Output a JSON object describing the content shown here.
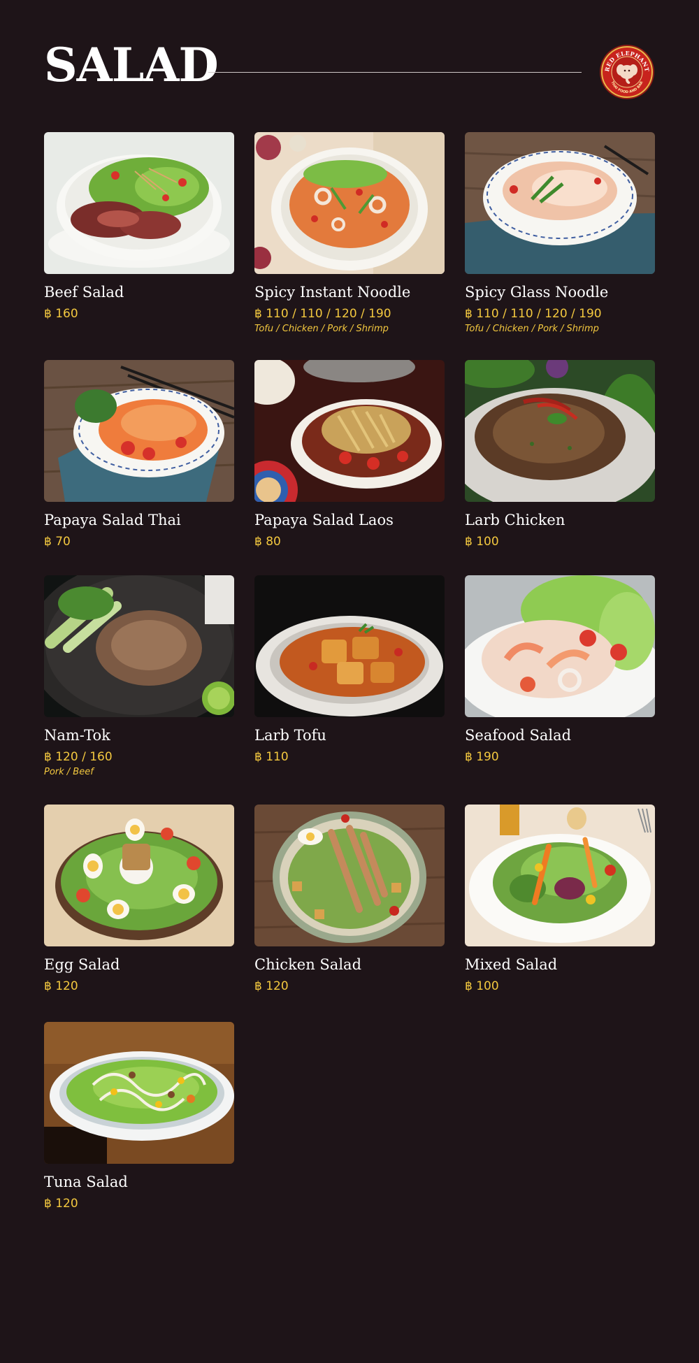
{
  "header": {
    "title": "SALAD",
    "logo": {
      "top_text": "RED ELEPHANT",
      "bottom_text": "THAI FOOD AND BAR",
      "icon": "elephant-icon"
    }
  },
  "colors": {
    "background": "#1e1418",
    "title": "#ffffff",
    "price": "#f3c83f",
    "logo_red": "#c8231d"
  },
  "menu": {
    "items": [
      {
        "name": "Beef Salad",
        "price": "฿ 160",
        "variants": "",
        "image": "beef-salad-photo"
      },
      {
        "name": "Spicy Instant Noodle",
        "price": "฿ 110 / 110 / 120 / 190",
        "variants": "Tofu / Chicken / Pork / Shrimp",
        "image": "spicy-instant-noodle-photo"
      },
      {
        "name": "Spicy Glass Noodle",
        "price": "฿ 110 / 110 / 120 / 190",
        "variants": "Tofu / Chicken / Pork / Shrimp",
        "image": "spicy-glass-noodle-photo"
      },
      {
        "name": "Papaya Salad Thai",
        "price": "฿ 70",
        "variants": "",
        "image": "papaya-salad-thai-photo"
      },
      {
        "name": "Papaya Salad Laos",
        "price": "฿ 80",
        "variants": "",
        "image": "papaya-salad-laos-photo"
      },
      {
        "name": "Larb Chicken",
        "price": "฿ 100",
        "variants": "",
        "image": "larb-chicken-photo"
      },
      {
        "name": "Nam-Tok",
        "price": "฿ 120 / 160",
        "variants": "Pork / Beef",
        "image": "nam-tok-photo"
      },
      {
        "name": "Larb Tofu",
        "price": "฿ 110",
        "variants": "",
        "image": "larb-tofu-photo"
      },
      {
        "name": "Seafood Salad",
        "price": "฿ 190",
        "variants": "",
        "image": "seafood-salad-photo"
      },
      {
        "name": "Egg Salad",
        "price": "฿ 120",
        "variants": "",
        "image": "egg-salad-photo"
      },
      {
        "name": "Chicken Salad",
        "price": "฿ 120",
        "variants": "",
        "image": "chicken-salad-photo"
      },
      {
        "name": "Mixed Salad",
        "price": "฿ 100",
        "variants": "",
        "image": "mixed-salad-photo"
      },
      {
        "name": "Tuna Salad",
        "price": "฿ 120",
        "variants": "",
        "image": "tuna-salad-photo"
      }
    ]
  }
}
